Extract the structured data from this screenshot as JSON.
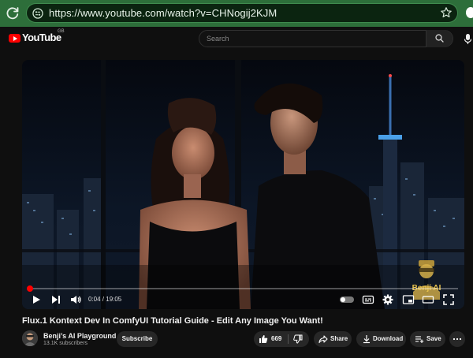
{
  "browser": {
    "url": "https://www.youtube.com/watch?v=CHNogij2KJM"
  },
  "header": {
    "logo_text": "YouTube",
    "logo_region": "GB",
    "search_placeholder": "Search"
  },
  "player": {
    "time": "0:04 / 19:05",
    "progress": 0.0035,
    "watermark_text": "Benji AI"
  },
  "video": {
    "title": "Flux.1 Kontext Dev In ComfyUI Tutorial Guide - Edit Any Image You Want!"
  },
  "channel": {
    "name": "Benji’s AI Playground",
    "subscribers": "13.1K subscribers",
    "subscribe_label": "Subscribe"
  },
  "actions": {
    "likes": "669",
    "share_label": "Share",
    "download_label": "Download",
    "save_label": "Save"
  },
  "colors": {
    "browser_chrome": "#2d6e3a",
    "accent": "#ff0000",
    "background": "#0f0f0f"
  }
}
